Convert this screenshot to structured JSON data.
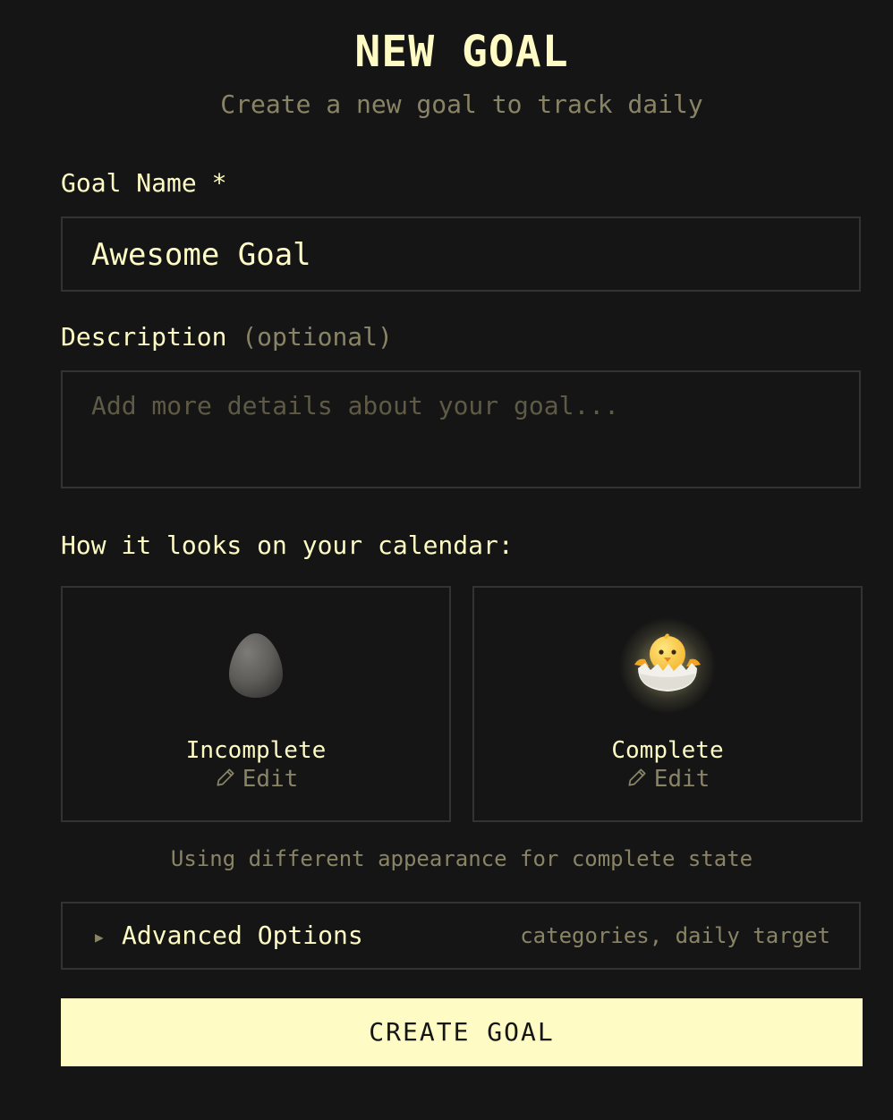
{
  "header": {
    "title": "NEW GOAL",
    "subtitle": "Create a new goal to track daily"
  },
  "form": {
    "goal_name": {
      "label": "Goal Name *",
      "value": "Awesome Goal"
    },
    "description": {
      "label": "Description",
      "label_hint": "(optional)",
      "placeholder": "Add more details about your goal...",
      "value": ""
    }
  },
  "calendar_preview": {
    "heading": "How it looks on your calendar:",
    "incomplete": {
      "state_label": "Incomplete",
      "edit_label": "Edit",
      "icon": "egg-icon"
    },
    "complete": {
      "state_label": "Complete",
      "edit_label": "Edit",
      "icon": "hatching-chick-icon"
    },
    "note": "Using different appearance for complete state"
  },
  "advanced": {
    "label": "Advanced Options",
    "hint": "categories, daily target",
    "expanded": false
  },
  "actions": {
    "create_label": "CREATE GOAL"
  },
  "colors": {
    "background": "#151515",
    "accent": "#fefcc4",
    "muted": "#8a8466",
    "border": "#333333"
  }
}
